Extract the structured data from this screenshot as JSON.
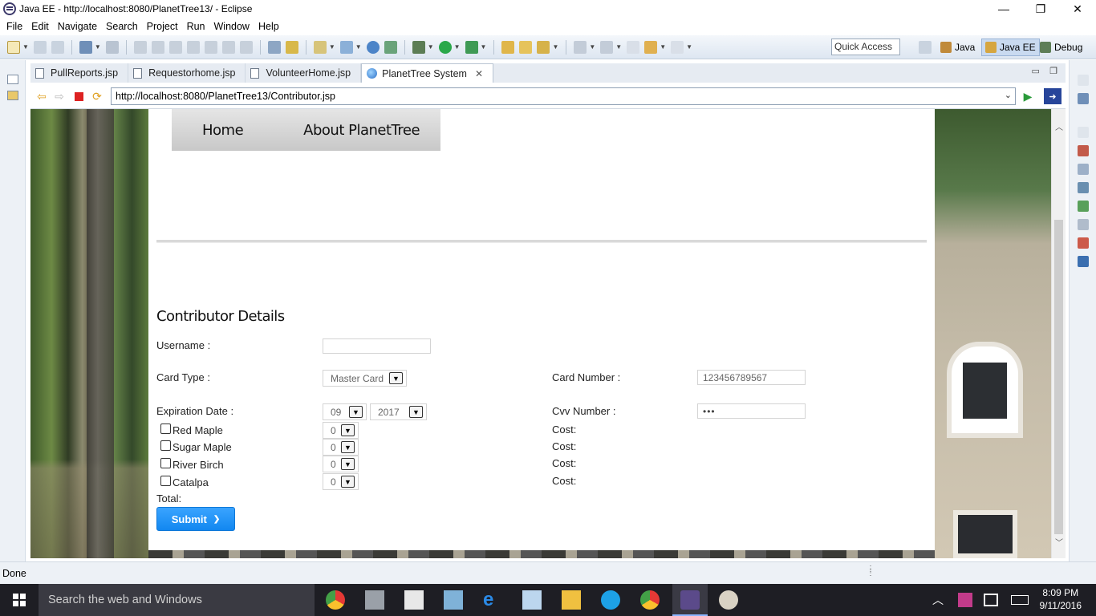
{
  "window": {
    "title": "Java EE - http://localhost:8080/PlanetTree13/ - Eclipse",
    "controls": [
      "—",
      "❐",
      "✕"
    ]
  },
  "menu": [
    "File",
    "Edit",
    "Navigate",
    "Search",
    "Project",
    "Run",
    "Window",
    "Help"
  ],
  "toolbar": {
    "quick_access": "Quick Access",
    "perspectives": [
      {
        "label": "Java",
        "icon": "java-perspective-icon"
      },
      {
        "label": "Java EE",
        "icon": "javaee-perspective-icon"
      },
      {
        "label": "Debug",
        "icon": "debug-perspective-icon"
      }
    ]
  },
  "editor_tabs": [
    {
      "label": "PullReports.jsp",
      "active": false
    },
    {
      "label": "Requestorhome.jsp",
      "active": false
    },
    {
      "label": "VolunteerHome.jsp",
      "active": false
    },
    {
      "label": "PlanetTree System",
      "active": true
    }
  ],
  "browser": {
    "url": "http://localhost:8080/PlanetTree13/Contributor.jsp"
  },
  "site_nav": {
    "home": "Home",
    "about": "About PlanetTree"
  },
  "form": {
    "heading": "Contributor Details",
    "username_label": "Username :",
    "username_value": "",
    "card_type_label": "Card Type :",
    "card_type_value": "Master Card",
    "card_number_label": "Card Number :",
    "card_number_value": "123456789567",
    "expiration_label": "Expiration Date :",
    "exp_month": "09",
    "exp_year": "2017",
    "cvv_label": "Cvv Number :",
    "cvv_value": "•••",
    "trees": [
      {
        "name": "Red Maple",
        "qty": "0",
        "cost_label": "Cost:"
      },
      {
        "name": "Sugar Maple",
        "qty": "0",
        "cost_label": "Cost:"
      },
      {
        "name": "River Birch",
        "qty": "0",
        "cost_label": "Cost:"
      },
      {
        "name": "Catalpa",
        "qty": "0",
        "cost_label": "Cost:"
      }
    ],
    "total_label": "Total:",
    "submit_label": "Submit"
  },
  "status": "Done",
  "taskbar": {
    "search_placeholder": "Search the web and Windows",
    "time": "8:09 PM",
    "date": "9/11/2016"
  },
  "colors": {
    "submit_blue": "#1a8ff5",
    "toolbar_bg": "#dde6f1",
    "taskbar_bg": "#1e1e24"
  }
}
